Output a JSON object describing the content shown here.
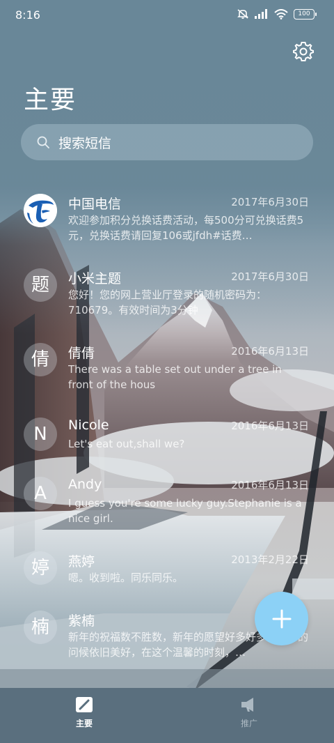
{
  "status_bar": {
    "time": "8:16",
    "battery": "100",
    "icons": [
      "mute-icon",
      "signal-icon",
      "wifi-icon",
      "battery-icon"
    ]
  },
  "header": {
    "title": "主要",
    "settings_icon": "gear-icon"
  },
  "search": {
    "placeholder": "搜索短信",
    "icon": "search-icon"
  },
  "messages": [
    {
      "avatar": "logo",
      "name": "中国电信",
      "date": "2017年6月30日",
      "preview": "欢迎参加积分兑换话费活动，每500分可兑换话费5元，兑换话费请回复106或jfdh#话费…"
    },
    {
      "avatar": "题",
      "name": "小米主题",
      "date": "2017年6月30日",
      "preview": "您好！您的网上营业厅登录的随机密码为：710679。有效时间为3分钟"
    },
    {
      "avatar": "倩",
      "name": "倩倩",
      "date": "2016年6月13日",
      "preview": "There was a table set out under a tree in front of the hous"
    },
    {
      "avatar": "N",
      "name": "Nicole",
      "date": "2016年6月13日",
      "preview": "Let's eat out,shall we?"
    },
    {
      "avatar": "A",
      "name": "Andy",
      "date": "2016年6月13日",
      "preview": "I guess you're some lucky guy.Stephanie is a nice girl."
    },
    {
      "avatar": "婷",
      "name": "燕婷",
      "date": "2013年2月22日",
      "preview": "嗯。收到啦。同乐同乐。"
    },
    {
      "avatar": "楠",
      "name": "紫楠",
      "date": "2013",
      "preview": "新年的祝福数不胜数，新年的愿望好多好多，新年的问候依旧美好，在这个温馨的时刻，…"
    }
  ],
  "fab": {
    "icon": "plus-icon",
    "color": "#8cd1f6"
  },
  "bottom_nav": {
    "items": [
      {
        "label": "主要",
        "icon": "messages-icon",
        "active": true
      },
      {
        "label": "推广",
        "icon": "megaphone-icon",
        "active": false
      }
    ]
  },
  "colors": {
    "accent": "#8cd1f6",
    "nav_background": "#5a6f7e",
    "logo_blue": "#1a5fb4"
  }
}
